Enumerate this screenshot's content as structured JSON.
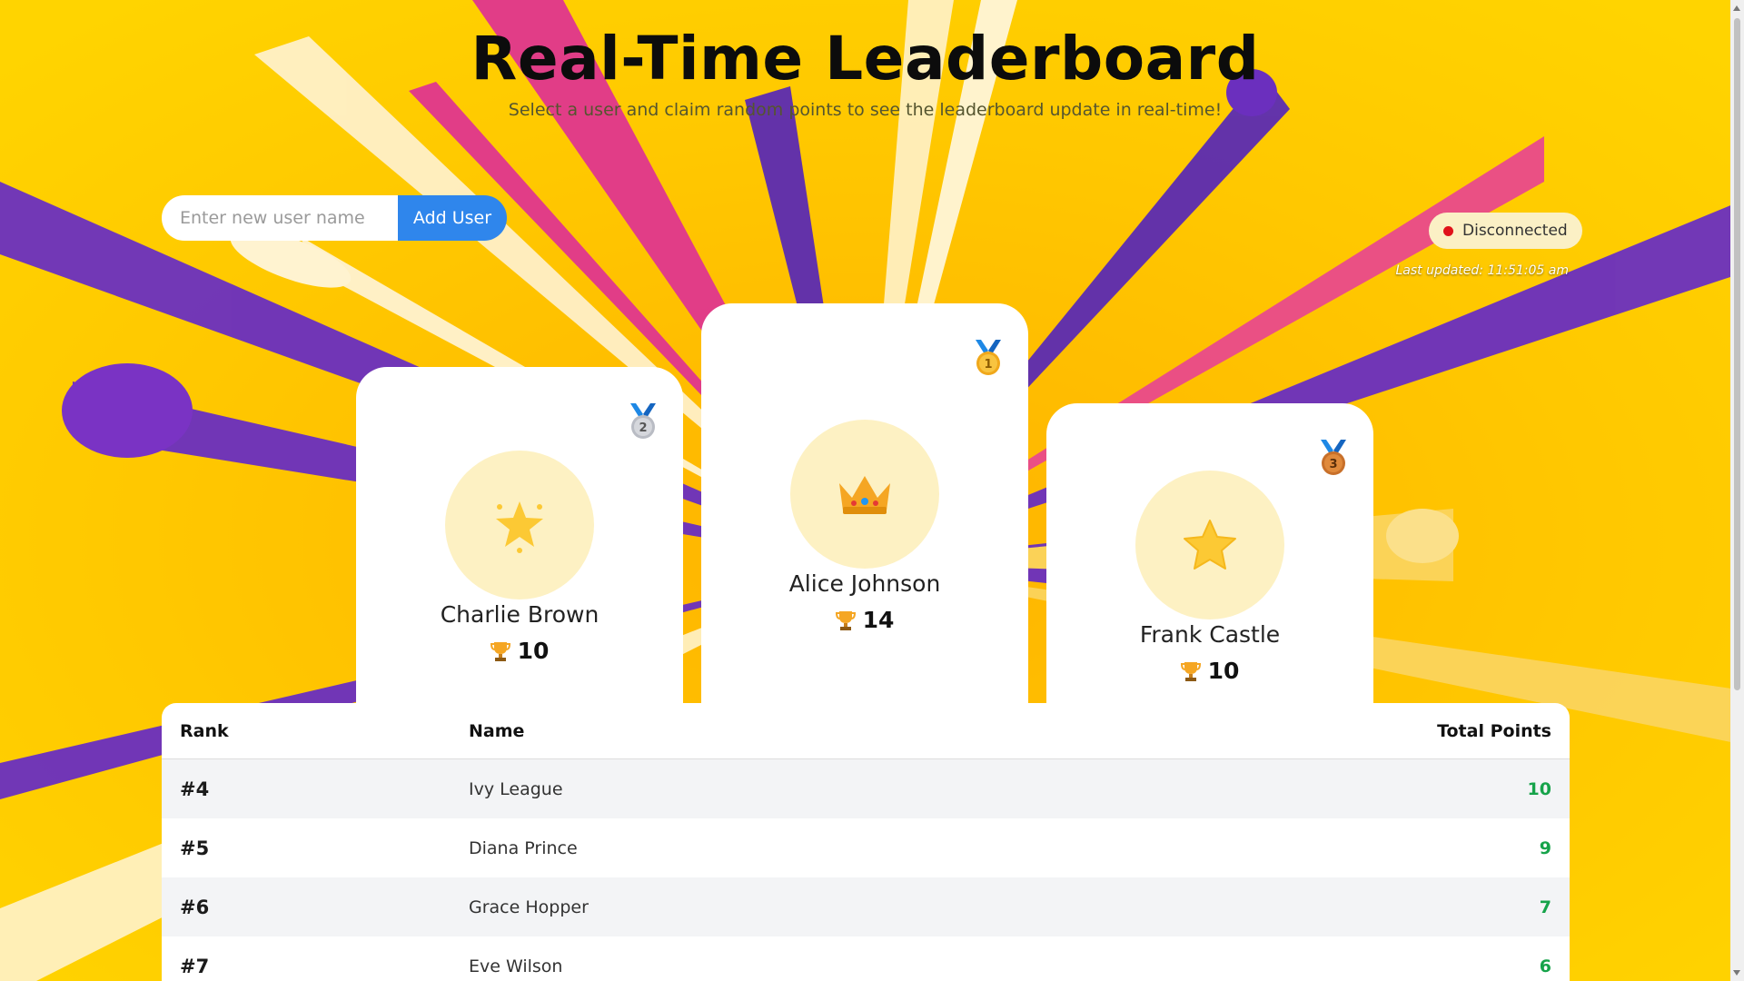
{
  "header": {
    "title": "Real-Time Leaderboard",
    "subtitle": "Select a user and claim random points to see the leaderboard update in real-time!"
  },
  "add_user": {
    "placeholder": "Enter new user name",
    "value": "",
    "button_label": "Add User"
  },
  "connection": {
    "status": "Disconnected",
    "status_color": "#e0121a",
    "last_updated": "Last updated: 11:51:05 am"
  },
  "podium": [
    {
      "rank": 1,
      "name": "Alice Johnson",
      "points": "14",
      "avatar_icon": "crown-icon",
      "medal_icon": "gold-medal-icon"
    },
    {
      "rank": 2,
      "name": "Charlie Brown",
      "points": "10",
      "avatar_icon": "sparkle-star-icon",
      "medal_icon": "silver-medal-icon"
    },
    {
      "rank": 3,
      "name": "Frank Castle",
      "points": "10",
      "avatar_icon": "star-icon",
      "medal_icon": "bronze-medal-icon"
    }
  ],
  "table": {
    "headers": {
      "rank": "Rank",
      "name": "Name",
      "points": "Total Points"
    },
    "rows": [
      {
        "rank": "#4",
        "name": "Ivy League",
        "points": "10"
      },
      {
        "rank": "#5",
        "name": "Diana Prince",
        "points": "9"
      },
      {
        "rank": "#6",
        "name": "Grace Hopper",
        "points": "7"
      },
      {
        "rank": "#7",
        "name": "Eve Wilson",
        "points": "6"
      }
    ]
  },
  "colors": {
    "background": "#ffd000",
    "accent_button": "#2f86ec",
    "points_green": "#16a34a",
    "avatar_bg": "#fdf1c3"
  }
}
